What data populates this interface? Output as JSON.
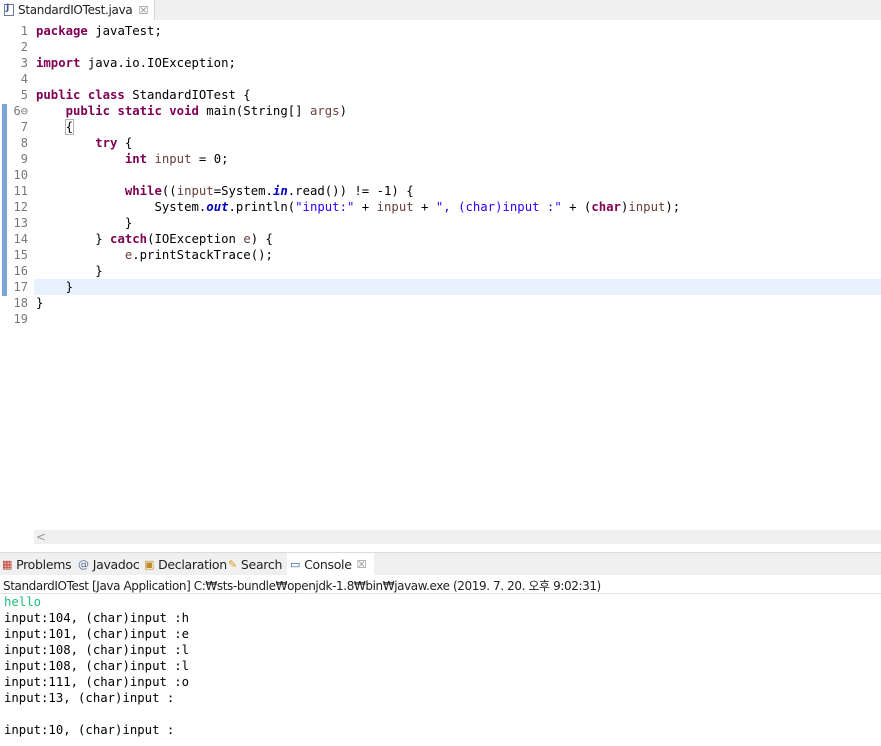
{
  "editor_tab": {
    "label": "StandardIOTest.java",
    "close": "☒"
  },
  "line_numbers": [
    "1",
    "2",
    "3",
    "4",
    "5",
    "6⊖",
    "7",
    "8",
    "9",
    "10",
    "11",
    "12",
    "13",
    "14",
    "15",
    "16",
    "17",
    "18",
    "19"
  ],
  "code": {
    "l1_kw": "package",
    "l1_rest": " javaTest;",
    "l3_kw": "import",
    "l3_rest": " java.io.IOException;",
    "l5_kw": "public class",
    "l5_rest": " StandardIOTest {",
    "l6_ind": "    ",
    "l6_kw": "public static void",
    "l6_a": " main(String[] ",
    "l6_var": "args",
    "l6_b": ")",
    "l7_ind": "    ",
    "l7_brace": "{",
    "l8_ind": "        ",
    "l8_kw": "try",
    "l8_rest": " {",
    "l9_ind": "            ",
    "l9_kw": "int",
    "l9_a": " ",
    "l9_var": "input",
    "l9_b": " = 0;",
    "l11_ind": "            ",
    "l11_kw": "while",
    "l11_a": "((",
    "l11_var": "input",
    "l11_b": "=System.",
    "l11_fld": "in",
    "l11_c": ".read()) != -1) {",
    "l12_ind": "                ",
    "l12_a": "System.",
    "l12_fld": "out",
    "l12_b": ".println(",
    "l12_s1": "\"input:\"",
    "l12_c": " + ",
    "l12_v1": "input",
    "l12_d": " + ",
    "l12_s2": "\", (char)input :\"",
    "l12_e": " + (",
    "l12_kw": "char",
    "l12_f": ")",
    "l12_v2": "input",
    "l12_g": ");",
    "l13_ind": "            ",
    "l13_rest": "}",
    "l14_ind": "        ",
    "l14_a": "} ",
    "l14_kw": "catch",
    "l14_b": "(IOException ",
    "l14_var": "e",
    "l14_c": ") {",
    "l15_ind": "            ",
    "l15_var": "e",
    "l15_rest": ".printStackTrace();",
    "l16_ind": "        ",
    "l16_rest": "}",
    "l17_ind": "    ",
    "l17_rest": "}",
    "l18_rest": "}"
  },
  "scroll_left": "<",
  "panel_tabs": {
    "problems": "Problems",
    "javadoc": "Javadoc",
    "declaration": "Declaration",
    "search": "Search",
    "console": "Console",
    "console_close": "☒"
  },
  "console": {
    "title": "StandardIOTest [Java Application] C:₩sts-bundle₩openjdk-1.8₩bin₩javaw.exe (2019. 7. 20. 오후 9:02:31)",
    "lines": [
      "hello",
      "input:104, (char)input :h",
      "input:101, (char)input :e",
      "input:108, (char)input :l",
      "input:108, (char)input :l",
      "input:111, (char)input :o",
      "input:13, (char)input :",
      "",
      "input:10, (char)input :"
    ]
  },
  "colors": {
    "keyword": "#7f0055",
    "string": "#2a00ff",
    "field": "#0000c0",
    "stdin": "#1cbf7b",
    "current_line": "#e8f2fe"
  }
}
